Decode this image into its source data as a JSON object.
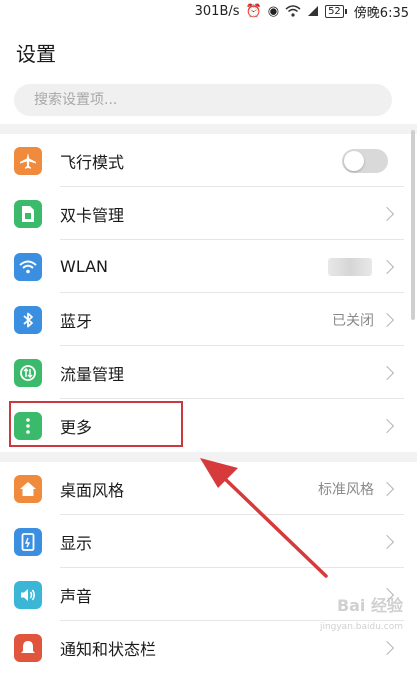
{
  "status_bar": {
    "speed": "301B/s",
    "battery": "52",
    "time": "傍晚6:35"
  },
  "page": {
    "title": "设置"
  },
  "search": {
    "placeholder": "搜索设置项..."
  },
  "items": [
    {
      "label": "飞行模式",
      "icon": "airplane-icon",
      "color": "#f08a3c",
      "control": "toggle",
      "toggle_on": false
    },
    {
      "label": "双卡管理",
      "icon": "sim-card-icon",
      "color": "#3cba6b",
      "control": "chevron"
    },
    {
      "label": "WLAN",
      "icon": "wifi-icon",
      "color": "#3b8fe0",
      "control": "chevron"
    },
    {
      "label": "蓝牙",
      "icon": "bluetooth-icon",
      "color": "#3b8fe0",
      "value": "已关闭",
      "control": "chevron"
    },
    {
      "label": "流量管理",
      "icon": "data-usage-icon",
      "color": "#3cba6b",
      "control": "chevron"
    },
    {
      "label": "更多",
      "icon": "more-dots-icon",
      "color": "#3cba6b",
      "control": "chevron"
    },
    {
      "label": "桌面风格",
      "icon": "home-icon",
      "color": "#f08a3c",
      "value": "标准风格",
      "control": "chevron"
    },
    {
      "label": "显示",
      "icon": "display-icon",
      "color": "#3b8fe0",
      "control": "chevron"
    },
    {
      "label": "声音",
      "icon": "speaker-icon",
      "color": "#3cb6d6",
      "control": "chevron"
    },
    {
      "label": "通知和状态栏",
      "icon": "notification-icon",
      "color": "#e0553b",
      "control": "chevron"
    }
  ],
  "watermark": {
    "text": "Bai 经验",
    "sub": "jingyan.baidu.com"
  },
  "colors": {
    "annotation_red": "#c9393f",
    "divider": "#e6e6e6",
    "section_gap": "#f2f2f2"
  }
}
